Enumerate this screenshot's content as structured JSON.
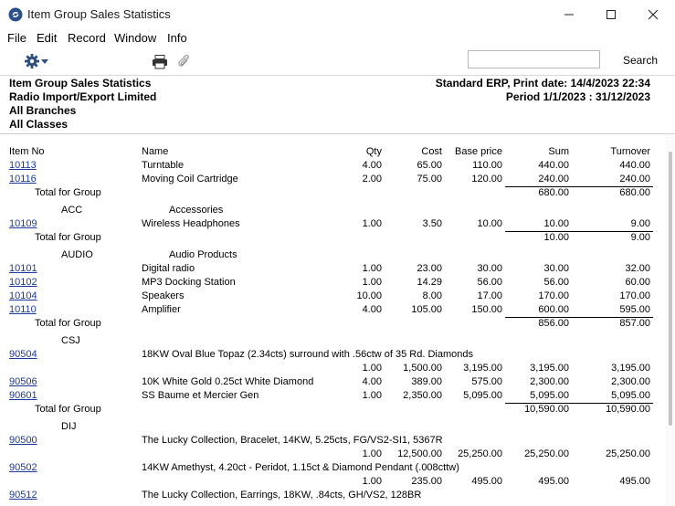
{
  "window": {
    "title": "Item Group Sales Statistics",
    "minimize_label": "─",
    "maximize_label": "☐",
    "close_label": "✕"
  },
  "menu": {
    "items": [
      "File",
      "Edit",
      "Record",
      "Window",
      "Info"
    ]
  },
  "toolbar": {
    "search_label": "Search",
    "search_value": "",
    "icons": [
      "gear-icon",
      "printer-icon",
      "paperclip-icon"
    ]
  },
  "header": {
    "report_title": "Item Group Sales Statistics",
    "company": "Radio Import/Export Limited",
    "branches": "All Branches",
    "classes": "All Classes",
    "print_info": "Standard ERP, Print date:  14/4/2023 22:34",
    "period": "Period  1/1/2023 : 31/12/2023"
  },
  "columns": {
    "item_no": "Item No",
    "name": "Name",
    "qty": "Qty",
    "cost": "Cost",
    "base_price": "Base price",
    "sum": "Sum",
    "turnover": "Turnover"
  },
  "rows": [
    {
      "type": "item",
      "item_no": "10113",
      "name": "Turntable",
      "qty": "4.00",
      "cost": "65.00",
      "base": "110.00",
      "sum": "440.00",
      "turnover": "440.00"
    },
    {
      "type": "item",
      "item_no": "10116",
      "name": "Moving Coil Cartridge",
      "qty": "2.00",
      "cost": "75.00",
      "base": "120.00",
      "sum": "240.00",
      "turnover": "240.00"
    },
    {
      "type": "total",
      "label": "Total for Group",
      "sum": "680.00",
      "turnover": "680.00"
    },
    {
      "type": "group",
      "code": "ACC",
      "name": "Accessories"
    },
    {
      "type": "item",
      "item_no": "10109",
      "name": "Wireless Headphones",
      "qty": "1.00",
      "cost": "3.50",
      "base": "10.00",
      "sum": "10.00",
      "turnover": "9.00"
    },
    {
      "type": "total",
      "label": "Total for Group",
      "sum": "10.00",
      "turnover": "9.00"
    },
    {
      "type": "group",
      "code": "AUDIO",
      "name": "Audio Products"
    },
    {
      "type": "item",
      "item_no": "10101",
      "name": "Digital radio",
      "qty": "1.00",
      "cost": "23.00",
      "base": "30.00",
      "sum": "30.00",
      "turnover": "32.00"
    },
    {
      "type": "item",
      "item_no": "10102",
      "name": "MP3 Docking Station",
      "qty": "1.00",
      "cost": "14.29",
      "base": "56.00",
      "sum": "56.00",
      "turnover": "60.00"
    },
    {
      "type": "item",
      "item_no": "10104",
      "name": "Speakers",
      "qty": "10.00",
      "cost": "8.00",
      "base": "17.00",
      "sum": "170.00",
      "turnover": "170.00"
    },
    {
      "type": "item",
      "item_no": "10110",
      "name": "Amplifier",
      "qty": "4.00",
      "cost": "105.00",
      "base": "150.00",
      "sum": "600.00",
      "turnover": "595.00"
    },
    {
      "type": "total",
      "label": "Total for Group",
      "sum": "856.00",
      "turnover": "857.00"
    },
    {
      "type": "group",
      "code": "CSJ",
      "name": ""
    },
    {
      "type": "longname",
      "item_no": "90504",
      "name": "18KW Oval Blue Topaz (2.34cts) surround with .56ctw of 35 Rd. Diamonds"
    },
    {
      "type": "values",
      "qty": "1.00",
      "cost": "1,500.00",
      "base": "3,195.00",
      "sum": "3,195.00",
      "turnover": "3,195.00"
    },
    {
      "type": "item",
      "item_no": "90506",
      "name": "10K White Gold 0.25ct White Diamond",
      "qty": "4.00",
      "cost": "389.00",
      "base": "575.00",
      "sum": "2,300.00",
      "turnover": "2,300.00"
    },
    {
      "type": "item",
      "item_no": "90601",
      "name": "SS Baume et Mercier Gen",
      "qty": "1.00",
      "cost": "2,350.00",
      "base": "5,095.00",
      "sum": "5,095.00",
      "turnover": "5,095.00"
    },
    {
      "type": "total",
      "label": "Total for Group",
      "sum": "10,590.00",
      "turnover": "10,590.00"
    },
    {
      "type": "group",
      "code": "DIJ",
      "name": ""
    },
    {
      "type": "longname",
      "item_no": "90500",
      "name": "The Lucky Collection, Bracelet, 14KW, 5.25cts, FG/VS2-SI1, 5367R"
    },
    {
      "type": "values",
      "qty": "1.00",
      "cost": "12,500.00",
      "base": "25,250.00",
      "sum": "25,250.00",
      "turnover": "25,250.00"
    },
    {
      "type": "longname",
      "item_no": "90502",
      "name": "14KW Amethyst, 4.20ct - Peridot, 1.15ct & Diamond Pendant (.008cttw)"
    },
    {
      "type": "values",
      "qty": "1.00",
      "cost": "235.00",
      "base": "495.00",
      "sum": "495.00",
      "turnover": "495.00"
    },
    {
      "type": "longname",
      "item_no": "90512",
      "name": "The Lucky Collection, Earrings, 18KW, .84cts, GH/VS2, 128BR"
    }
  ]
}
